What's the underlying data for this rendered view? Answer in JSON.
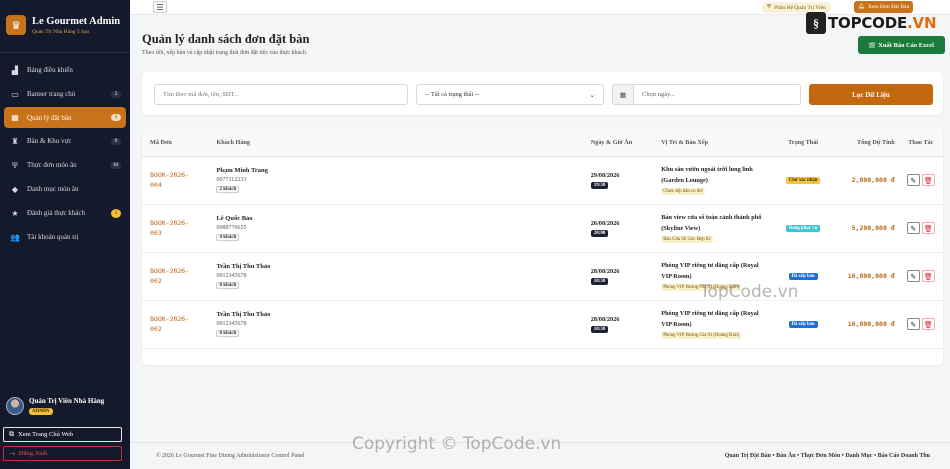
{
  "brand": {
    "title": "Le Gourmet Admin",
    "subtitle": "Quản Trị Nhà Hàng 5 Sao"
  },
  "sidebar": {
    "items": [
      {
        "label": "Bảng điều khiển",
        "icon": "dashboard-icon",
        "glyph": "▟",
        "badge": ""
      },
      {
        "label": "Banner trang chủ",
        "icon": "image-icon",
        "glyph": "▭",
        "badge": "3"
      },
      {
        "label": "Quản lý đặt bàn",
        "icon": "calendar-icon",
        "glyph": "▦",
        "badge": "4"
      },
      {
        "label": "Bàn & Khu vực",
        "icon": "chair-icon",
        "glyph": "♜",
        "badge": "9"
      },
      {
        "label": "Thực đơn món ăn",
        "icon": "utensils-icon",
        "glyph": "Ψ",
        "badge": "10"
      },
      {
        "label": "Danh mục món ăn",
        "icon": "layers-icon",
        "glyph": "◆",
        "badge": ""
      },
      {
        "label": "Đánh giá thực khách",
        "icon": "star-icon",
        "glyph": "★",
        "badge": "3"
      },
      {
        "label": "Tài khoản quản trị",
        "icon": "users-icon",
        "glyph": "👥",
        "badge": ""
      }
    ]
  },
  "profile": {
    "name": "Quản Trị Viên Nhà Hàng",
    "role": "ADMIN"
  },
  "sidebar_buttons": {
    "web": "Xem Trang Chủ Web",
    "logout": "Đăng Xuất"
  },
  "topbar": {
    "admin_pill": "Phần Hệ Quản Trị Viên",
    "view_orders": "Xem Đơn Đặt Bàn"
  },
  "page": {
    "title": "Quản lý danh sách đơn đặt bàn",
    "subtitle": "Theo dõi, xếp bàn và cập nhật trạng thái đơn đặt tiệc của thực khách.",
    "export_button": "Xuất Báo Cáo Excel"
  },
  "filters": {
    "search_placeholder": "Tìm theo mã đơn, tên, SĐT...",
    "status_selected": "-- Tất cả trạng thái --",
    "date_placeholder": "Chọn ngày...",
    "filter_button": "Lọc Dữ Liệu"
  },
  "table": {
    "headers": [
      "Mã Đơn",
      "Khách Hàng",
      "Ngày & Giờ Ăn",
      "Vị Trí & Bàn Xếp",
      "Trạng Thái",
      "Tổng Dự Tính",
      "Thao Tác"
    ],
    "rows": [
      {
        "code1": "BOOK-2026-",
        "code2": "004",
        "name": "Phạm Minh Trang",
        "phone": "0977112233",
        "guests": "2 khách",
        "date": "29/08/2026",
        "time": "19:30",
        "position": "Khu sân vườn ngoài trời lung linh (Garden Lounge)",
        "table_badge": "Chưa xếp bàn cụ thể",
        "status": "Chờ xác nhận",
        "status_color": "#f6c343",
        "total": "2,800,000 đ"
      },
      {
        "code1": "BOOK-2026-",
        "code2": "003",
        "name": "Lê Quốc Bảo",
        "phone": "0988776655",
        "guests": "4 khách",
        "date": "26/08/2026",
        "time": "20:00",
        "position": "Bàn view cửa sổ toàn cảnh thành phố (Skyline View)",
        "table_badge": "Bàn Cửa Sổ Góc Đẹp 02",
        "status": "Đang phục vụ",
        "status_color": "#3fc3d8",
        "total": "5,200,000 đ"
      },
      {
        "code1": "BOOK-2026-",
        "code2": "002",
        "name": "Trần Thị Thu Thảo",
        "phone": "0912345678",
        "guests": "8 khách",
        "date": "28/08/2026",
        "time": "18:30",
        "position": "Phòng VIP riêng tư đẳng cấp (Royal VIP Room)",
        "table_badge": "Phòng VIP Hoàng Gia 01 (Hoàng Kim)",
        "status": "Đã xếp bàn",
        "status_color": "#1f6fd6",
        "total": "16,800,000 đ"
      },
      {
        "code1": "BOOK-2026-",
        "code2": "002",
        "name": "Trần Thị Thu Thảo",
        "phone": "0912345678",
        "guests": "8 khách",
        "date": "28/08/2026",
        "time": "18:30",
        "position": "Phòng VIP riêng tư đẳng cấp (Royal VIP Room)",
        "table_badge": "Phòng VIP Hoàng Gia 01 (Hoàng Kim)",
        "status": "Đã xếp bàn",
        "status_color": "#1f6fd6",
        "total": "16,800,000 đ"
      }
    ]
  },
  "footer": {
    "left": "© 2026 Le Gourmet Fine Dining Administrator Control Panel",
    "right": "Quản Trị Đặt Bàn • Bàn Ăn • Thực Đơn Món • Danh Mục • Báo Cáo Doanh Thu"
  },
  "watermark": {
    "logo_a": "TOPCODE",
    "logo_b": ".VN",
    "mid": "TopCode.vn",
    "bottom": "Copyright © TopCode.vn"
  }
}
